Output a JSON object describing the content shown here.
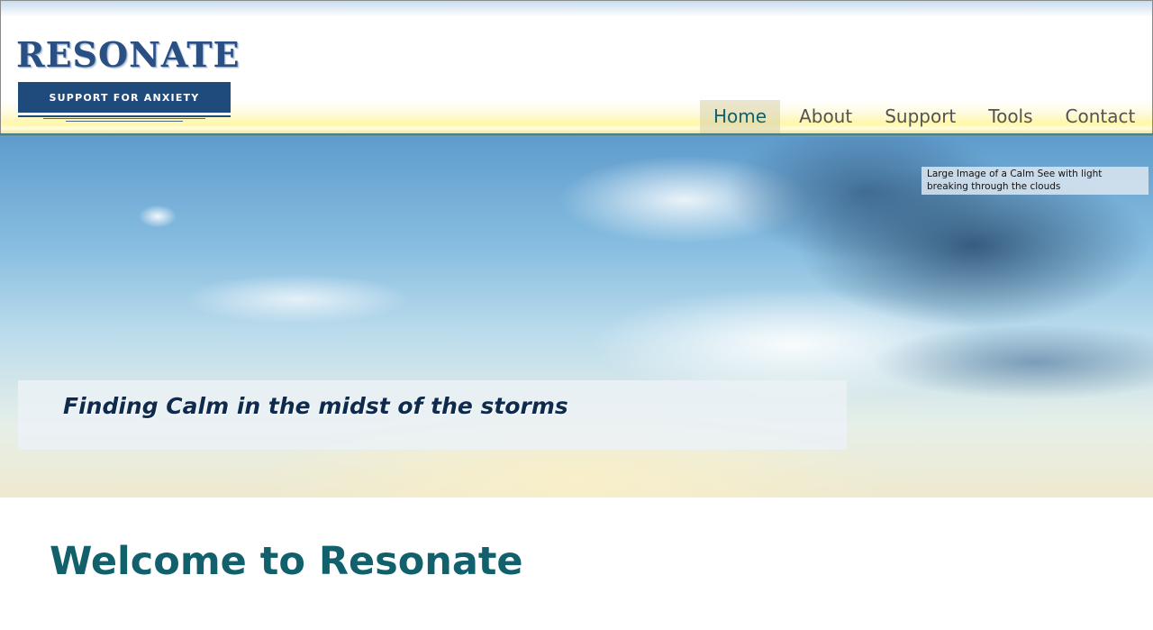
{
  "header": {
    "logo_word": "RESONATE",
    "logo_tagline": "SUPPORT FOR ANXIETY"
  },
  "nav": {
    "items": [
      {
        "label": "Home",
        "active": true
      },
      {
        "label": "About",
        "active": false
      },
      {
        "label": "Support",
        "active": false
      },
      {
        "label": "Tools",
        "active": false
      },
      {
        "label": "Contact",
        "active": false
      }
    ]
  },
  "hero": {
    "image_alt": "Large Image of a Calm See with light breaking through the clouds",
    "caption": "Finding Calm in the midst of the storms"
  },
  "main": {
    "heading": "Welcome to Resonate"
  },
  "colors": {
    "accent_teal": "#11606c",
    "logo_blue": "#1f4a7c",
    "caption_navy": "#0e2a4d"
  }
}
